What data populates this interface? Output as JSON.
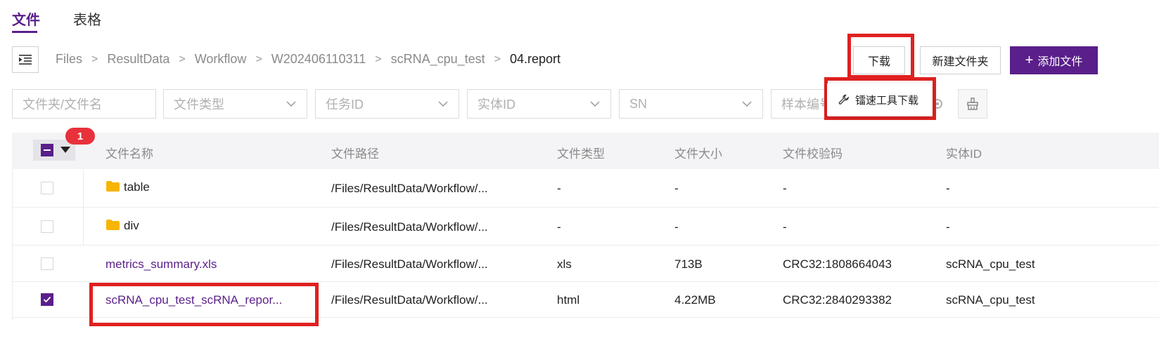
{
  "tabs": [
    {
      "label": "文件",
      "active": true
    },
    {
      "label": "表格",
      "active": false
    }
  ],
  "breadcrumb": [
    "Files",
    "ResultData",
    "Workflow",
    "W202406110311",
    "scRNA_cpu_test",
    "04.report"
  ],
  "breadcrumb_separator": ">",
  "toolbar": {
    "download_label": "下载",
    "new_folder_label": "新建文件夹",
    "add_file_plus": "+",
    "add_file_label": "添加文件"
  },
  "download_menu": {
    "items": [
      "镭速工具下载"
    ]
  },
  "filters": {
    "name_placeholder": "文件夹/文件名",
    "type_placeholder": "文件类型",
    "task_id_placeholder": "任务ID",
    "entity_id_placeholder": "实体ID",
    "sn_placeholder": "SN",
    "sample_placeholder": "样本编号"
  },
  "selection": {
    "selected_count": "1"
  },
  "table": {
    "headers": [
      "文件名称",
      "文件路径",
      "文件类型",
      "文件大小",
      "文件校验码",
      "实体ID"
    ],
    "rows": [
      {
        "name": "table",
        "is_folder": true,
        "path": "/Files/ResultData/Workflow/...",
        "type": "-",
        "size": "-",
        "checksum": "-",
        "entity": "-",
        "checked": false
      },
      {
        "name": "div",
        "is_folder": true,
        "path": "/Files/ResultData/Workflow/...",
        "type": "-",
        "size": "-",
        "checksum": "-",
        "entity": "-",
        "checked": false
      },
      {
        "name": "metrics_summary.xls",
        "is_folder": false,
        "path": "/Files/ResultData/Workflow/...",
        "type": "xls",
        "size": "713B",
        "checksum": "CRC32:1808664043",
        "entity": "scRNA_cpu_test",
        "checked": false
      },
      {
        "name": "scRNA_cpu_test_scRNA_repor...",
        "is_folder": false,
        "path": "/Files/ResultData/Workflow/...",
        "type": "html",
        "size": "4.22MB",
        "checksum": "CRC32:2840293382",
        "entity": "scRNA_cpu_test",
        "checked": true
      }
    ]
  },
  "colors": {
    "brand": "#5a1f8a",
    "highlight": "#e02020",
    "badge": "#e8313a",
    "folder": "#f7b500"
  }
}
